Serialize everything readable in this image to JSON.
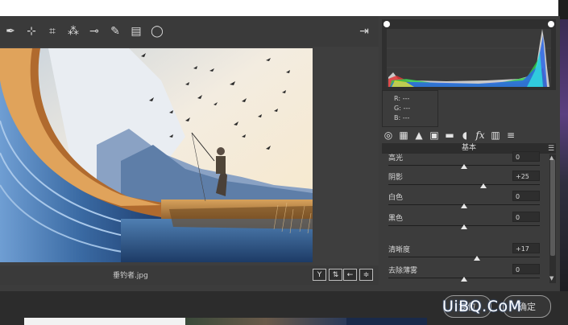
{
  "toolbar": {
    "tools": [
      {
        "name": "eyedropper-icon",
        "glyph": "✒"
      },
      {
        "name": "color-sampler-icon",
        "glyph": "⊹"
      },
      {
        "name": "crop-icon",
        "glyph": "⌗"
      },
      {
        "name": "spot-removal-icon",
        "glyph": "⁂"
      },
      {
        "name": "red-eye-icon",
        "glyph": "⊸"
      },
      {
        "name": "brush-icon",
        "glyph": "✎"
      },
      {
        "name": "graduated-filter-icon",
        "glyph": "▤"
      },
      {
        "name": "radial-filter-icon",
        "glyph": "◯"
      }
    ],
    "export_glyph": "⇥"
  },
  "image": {
    "filename": "垂钓者.jpg"
  },
  "statusbar": {
    "buttons": [
      {
        "name": "y-compare-button",
        "glyph": "Y"
      },
      {
        "name": "swap-button",
        "glyph": "⇅"
      },
      {
        "name": "copy-settings-button",
        "glyph": "←"
      },
      {
        "name": "preview-settings-button",
        "glyph": "≑"
      }
    ]
  },
  "rgb_readout": {
    "r_label": "R:",
    "g_label": "G:",
    "b_label": "B:",
    "r": "---",
    "g": "---",
    "b": "---"
  },
  "tabs": [
    {
      "name": "tab-basic-icon",
      "glyph": "◎"
    },
    {
      "name": "tab-tone-curve-icon",
      "glyph": "▦"
    },
    {
      "name": "tab-detail-icon",
      "glyph": "▲"
    },
    {
      "name": "tab-hsl-icon",
      "glyph": "▣"
    },
    {
      "name": "tab-split-toning-icon",
      "glyph": "▬"
    },
    {
      "name": "tab-lens-icon",
      "glyph": "◖"
    },
    {
      "name": "tab-effects-icon",
      "glyph": "fx"
    },
    {
      "name": "tab-calibration-icon",
      "glyph": "▥"
    },
    {
      "name": "tab-presets-icon",
      "glyph": "≡"
    }
  ],
  "panel": {
    "title": "基本",
    "menu_glyph": "☰"
  },
  "sliders": [
    {
      "label": "高光",
      "value": "0",
      "pos": 0.5
    },
    {
      "label": "阴影",
      "value": "+25",
      "pos": 0.625
    },
    {
      "label": "白色",
      "value": "0",
      "pos": 0.5
    },
    {
      "label": "黑色",
      "value": "0",
      "pos": 0.5
    },
    {
      "label": "清晰度",
      "value": "+17",
      "pos": 0.585
    },
    {
      "label": "去除薄雾",
      "value": "0",
      "pos": 0.5
    }
  ],
  "scroll": {
    "up": "▲",
    "down": "▼"
  },
  "buttons": {
    "reset": "复位",
    "ok": "确定"
  },
  "watermark": "UiBQ.CoM",
  "colors": {
    "accent": "#4a6ea8",
    "panel": "#3c3c3c"
  }
}
